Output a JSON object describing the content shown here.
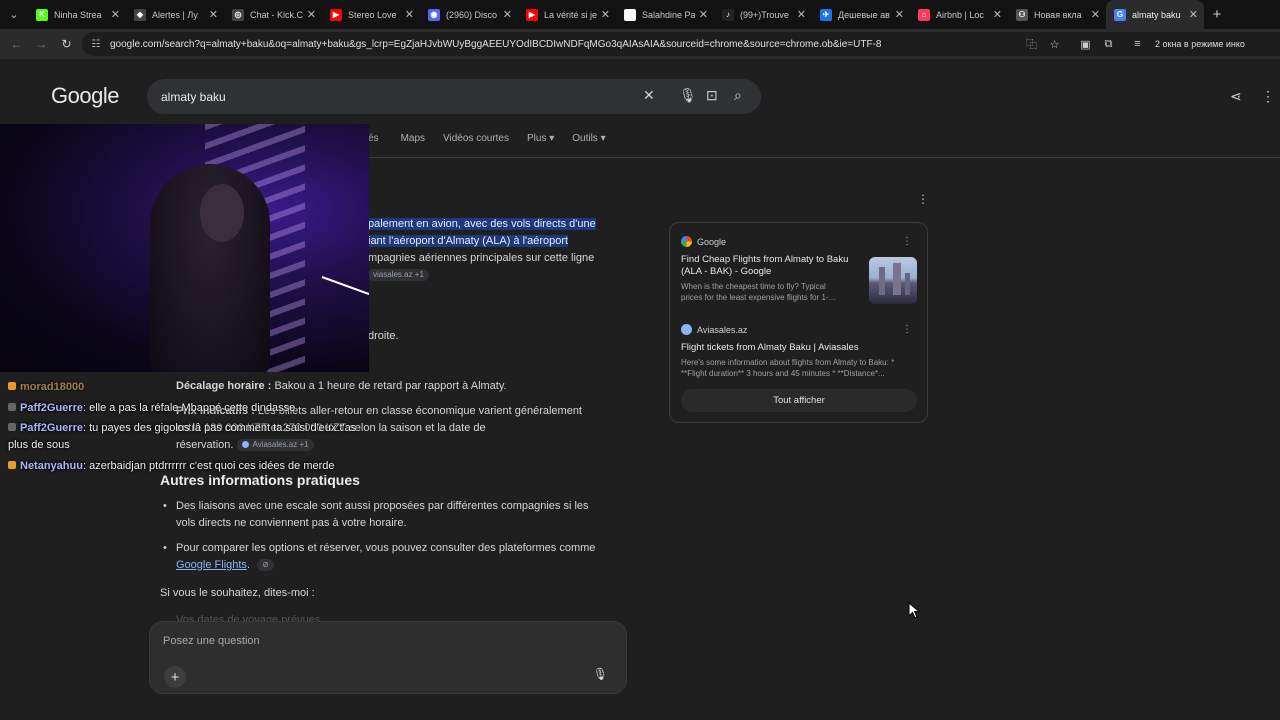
{
  "tabs": [
    {
      "title": "Ninha Strea",
      "color": "#53fc18",
      "glyph": "K"
    },
    {
      "title": "Alertes | Лу",
      "color": "#444444",
      "glyph": "◆"
    },
    {
      "title": "Chat - Kick.C",
      "color": "#444444",
      "glyph": "◎"
    },
    {
      "title": "Stereo Love",
      "color": "#ff0000",
      "glyph": "▶"
    },
    {
      "title": "(2960) Disco",
      "color": "#5865f2",
      "glyph": "◉"
    },
    {
      "title": "La vérité si je",
      "color": "#ff0000",
      "glyph": "▶"
    },
    {
      "title": "Salahdine Pa",
      "color": "#ffffff",
      "glyph": "▣"
    },
    {
      "title": "(99+)Trouve",
      "color": "#222222",
      "glyph": "♪"
    },
    {
      "title": "Дешевые ав",
      "color": "#1a73e8",
      "glyph": "✈"
    },
    {
      "title": "Airbnb | Loc",
      "color": "#ff385c",
      "glyph": "⌂"
    },
    {
      "title": "Новая вкла",
      "color": "#555555",
      "glyph": "⚇"
    },
    {
      "title": "almaty baku",
      "color": "#4285f4",
      "glyph": "G",
      "active": true
    }
  ],
  "toolbar": {
    "url": "google.com/search?q=almaty+baku&oq=almaty+baku&gs_lcrp=EgZjaHJvbWUyBggAEEUYOdIBCDIwNDFqMGo3qAIAsAIA&sourceid=chrome&source=chrome.ob&ie=UTF-8",
    "incognito_text": "2 окна в режиме инко"
  },
  "google": {
    "logo": "Google",
    "query": "almaty baku",
    "tabs": [
      "és",
      "Maps",
      "Vidéos courtes",
      "Plus ▾",
      "Outils ▾"
    ]
  },
  "answer": {
    "line1_hl": "palement en avion, avec des vols directs d'une",
    "line2_hl": "iant l'aéroport d'Almaty (ALA) à l'aéroport",
    "line3": "mpagnies aériennes principales sur cette ligne",
    "chip1": "viasales.az +1",
    "droite": "droite.",
    "decalage_label": "Décalage horaire :",
    "decalage_text": "Bakou a 1 heure de retard par rapport à Almaty.",
    "prix_label": "Prix indicatifs :",
    "prix_text": "Les billets aller-retour en classe économique varient généralement",
    "prix_text2": "entre 180 000 KZT et 270 000 KZT selon la saison et la date de",
    "prix_text3": "réservation.",
    "chip2": "Aviasales.az +1",
    "heading": "Autres informations pratiques",
    "bullet1": "Des liaisons avec une escale sont aussi proposées par différentes compagnies si les vols directs ne conviennent pas à votre horaire.",
    "bullet2_pre": "Pour comparer les options et réserver, vous pouvez consulter des plateformes comme",
    "bullet2_link": "Google Flights",
    "outro": "Si vous le souhaitez, dites-moi :",
    "faded": "Vos dates de voyage prévues"
  },
  "ask": {
    "placeholder": "Posez une question"
  },
  "sources": {
    "src1": "Google",
    "title1a": "Find Cheap Flights from Almaty to Baku",
    "title1b": "(ALA - BAK) - Google",
    "snip1a": "When is the cheapest time to fly? Typical",
    "snip1b": "prices for the least expensive flights for 1-...",
    "src2": "Aviasales.az",
    "title2": "Flight tickets from Almaty Baku | Aviasales",
    "snip2a": "Here's some information about flights from Almaty to Baku: *",
    "snip2b": "**Flight duration** 3 hours and 45 minutes * **Distance*...",
    "show_all": "Tout afficher"
  },
  "chat": [
    {
      "user": "Paff2Guerre",
      "text": "elle a pas la réfale Mbappé cette dindasse",
      "badge": "gray"
    },
    {
      "user": "Paff2Guerre",
      "text": "tu payes des gigolos lâ pas comment ta saisi d'eux t'as plus de sous",
      "badge": "gray"
    },
    {
      "user": "Netanyahuu",
      "text": "azerbaidjan ptdrrrrrr c'est quoi ces idées de merde",
      "badge": "orange"
    }
  ],
  "chat_partial_user": "morad18000",
  "colors": {
    "highlight": "#1c3a7a",
    "link": "#8ab4f8",
    "background": "#1f1f1f"
  }
}
